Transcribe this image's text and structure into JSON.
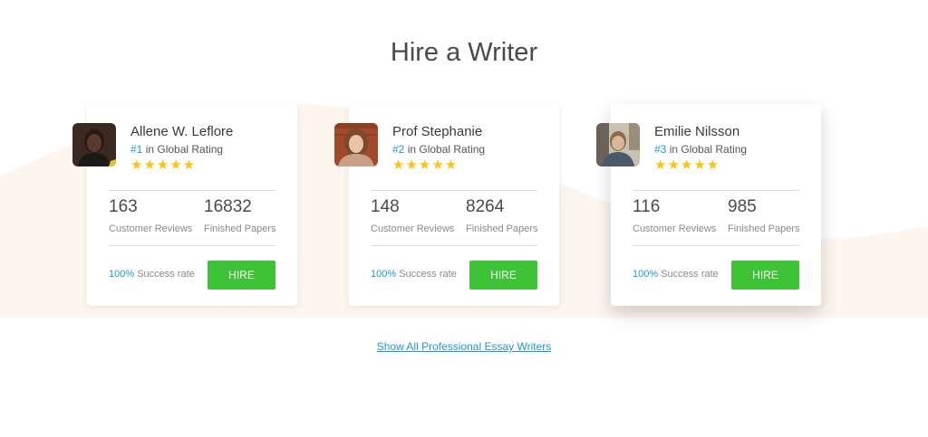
{
  "section": {
    "title": "Hire a Writer"
  },
  "writers": [
    {
      "name": "Allene W. Leflore",
      "rank": "#1",
      "rating_suffix": " in Global Rating",
      "stars": 5,
      "stars_text": "★★★★★",
      "customer_reviews": "163",
      "customer_reviews_label": "Customer Reviews",
      "finished_papers": "16832",
      "finished_papers_label": "Finished Papers",
      "success_pct": "100%",
      "success_label": " Success rate",
      "hire_label": "HIRE"
    },
    {
      "name": "Prof Stephanie",
      "rank": "#2",
      "rating_suffix": " in Global Rating",
      "stars": 5,
      "stars_text": "★★★★★",
      "customer_reviews": "148",
      "customer_reviews_label": "Customer Reviews",
      "finished_papers": "8264",
      "finished_papers_label": "Finished Papers",
      "success_pct": "100%",
      "success_label": " Success rate",
      "hire_label": "HIRE"
    },
    {
      "name": "Emilie Nilsson",
      "rank": "#3",
      "rating_suffix": " in Global Rating",
      "stars": 5,
      "stars_text": "★★★★★",
      "customer_reviews": "116",
      "customer_reviews_label": "Customer Reviews",
      "finished_papers": "985",
      "finished_papers_label": "Finished Papers",
      "success_pct": "100%",
      "success_label": " Success rate",
      "hire_label": "HIRE"
    }
  ],
  "show_all_link": "Show All Professional Essay Writers",
  "colors": {
    "accent_blue": "#2196d3",
    "hire_green": "#3ec336",
    "star_yellow": "#f5c518",
    "title_text": "#4a4a4a"
  }
}
